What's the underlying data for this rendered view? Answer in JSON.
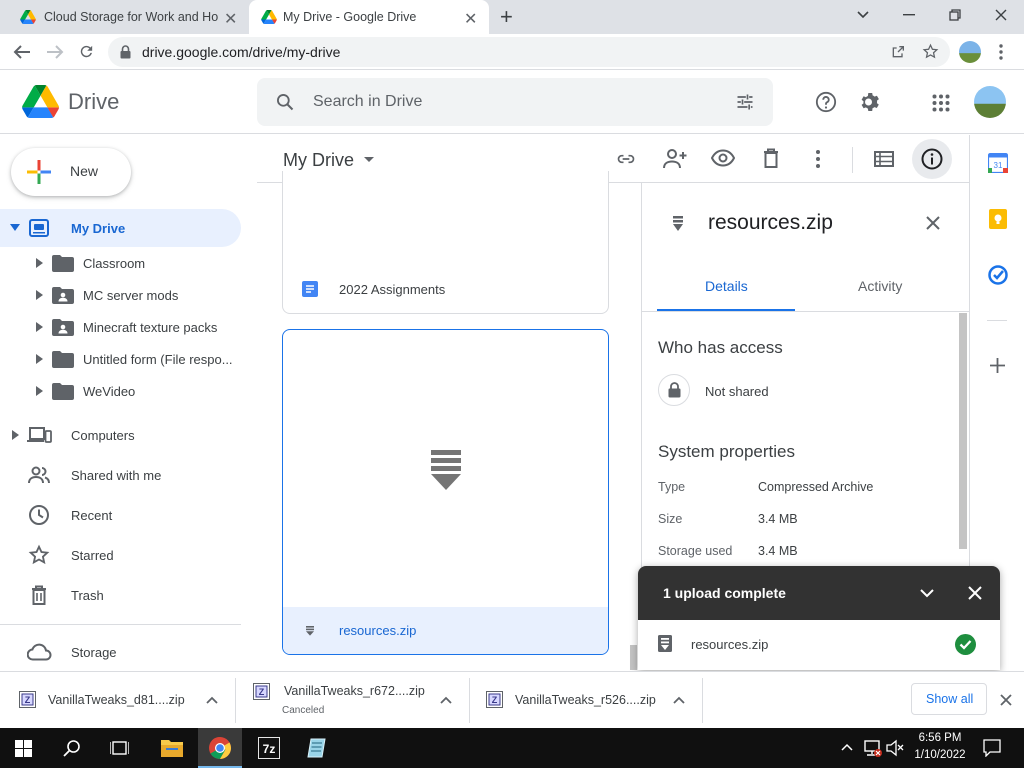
{
  "browser": {
    "tabs": [
      {
        "title": "Cloud Storage for Work and Hon",
        "active": false
      },
      {
        "title": "My Drive - Google Drive",
        "active": true
      }
    ],
    "url": "drive.google.com/drive/my-drive"
  },
  "drive": {
    "product_name": "Drive",
    "search_placeholder": "Search in Drive"
  },
  "sidebar": {
    "new_label": "New",
    "my_drive_label": "My Drive",
    "folders": [
      {
        "label": "Classroom",
        "icon": "folder-icon"
      },
      {
        "label": "MC server mods",
        "icon": "shared-folder-icon"
      },
      {
        "label": "Minecraft texture packs",
        "icon": "shared-folder-icon"
      },
      {
        "label": "Untitled form (File respo...",
        "icon": "folder-icon"
      },
      {
        "label": "WeVideo",
        "icon": "folder-icon"
      }
    ],
    "items": [
      {
        "label": "Computers",
        "icon": "computer-icon"
      },
      {
        "label": "Shared with me",
        "icon": "people-icon"
      },
      {
        "label": "Recent",
        "icon": "clock-icon"
      },
      {
        "label": "Starred",
        "icon": "star-icon"
      },
      {
        "label": "Trash",
        "icon": "trash-icon"
      }
    ],
    "storage_label": "Storage"
  },
  "main": {
    "title": "My Drive",
    "files": [
      {
        "name": "2022 Assignments",
        "icon": "docs-icon",
        "selected": false
      },
      {
        "name": "resources.zip",
        "icon": "zip-icon",
        "selected": true
      }
    ]
  },
  "details": {
    "file_name": "resources.zip",
    "tabs": [
      "Details",
      "Activity"
    ],
    "active_tab": "Details",
    "access_heading": "Who has access",
    "access_status": "Not shared",
    "props_heading": "System properties",
    "props": [
      {
        "key": "Type",
        "value": "Compressed Archive"
      },
      {
        "key": "Size",
        "value": "3.4 MB"
      },
      {
        "key": "Storage used",
        "value": "3.4 MB"
      }
    ]
  },
  "toast": {
    "title": "1 upload complete",
    "file": "resources.zip"
  },
  "downloads": {
    "items": [
      {
        "name": "VanillaTweaks_d81....zip",
        "status": ""
      },
      {
        "name": "VanillaTweaks_r672....zip",
        "status": "Canceled"
      },
      {
        "name": "VanillaTweaks_r526....zip",
        "status": ""
      }
    ],
    "show_all": "Show all"
  },
  "taskbar": {
    "time": "6:56 PM",
    "date": "1/10/2022"
  },
  "colors": {
    "accent": "#1a73e8",
    "selected_nav_bg": "#e8f0fe",
    "toast_bg": "#323232",
    "success": "#1e8e3e"
  }
}
